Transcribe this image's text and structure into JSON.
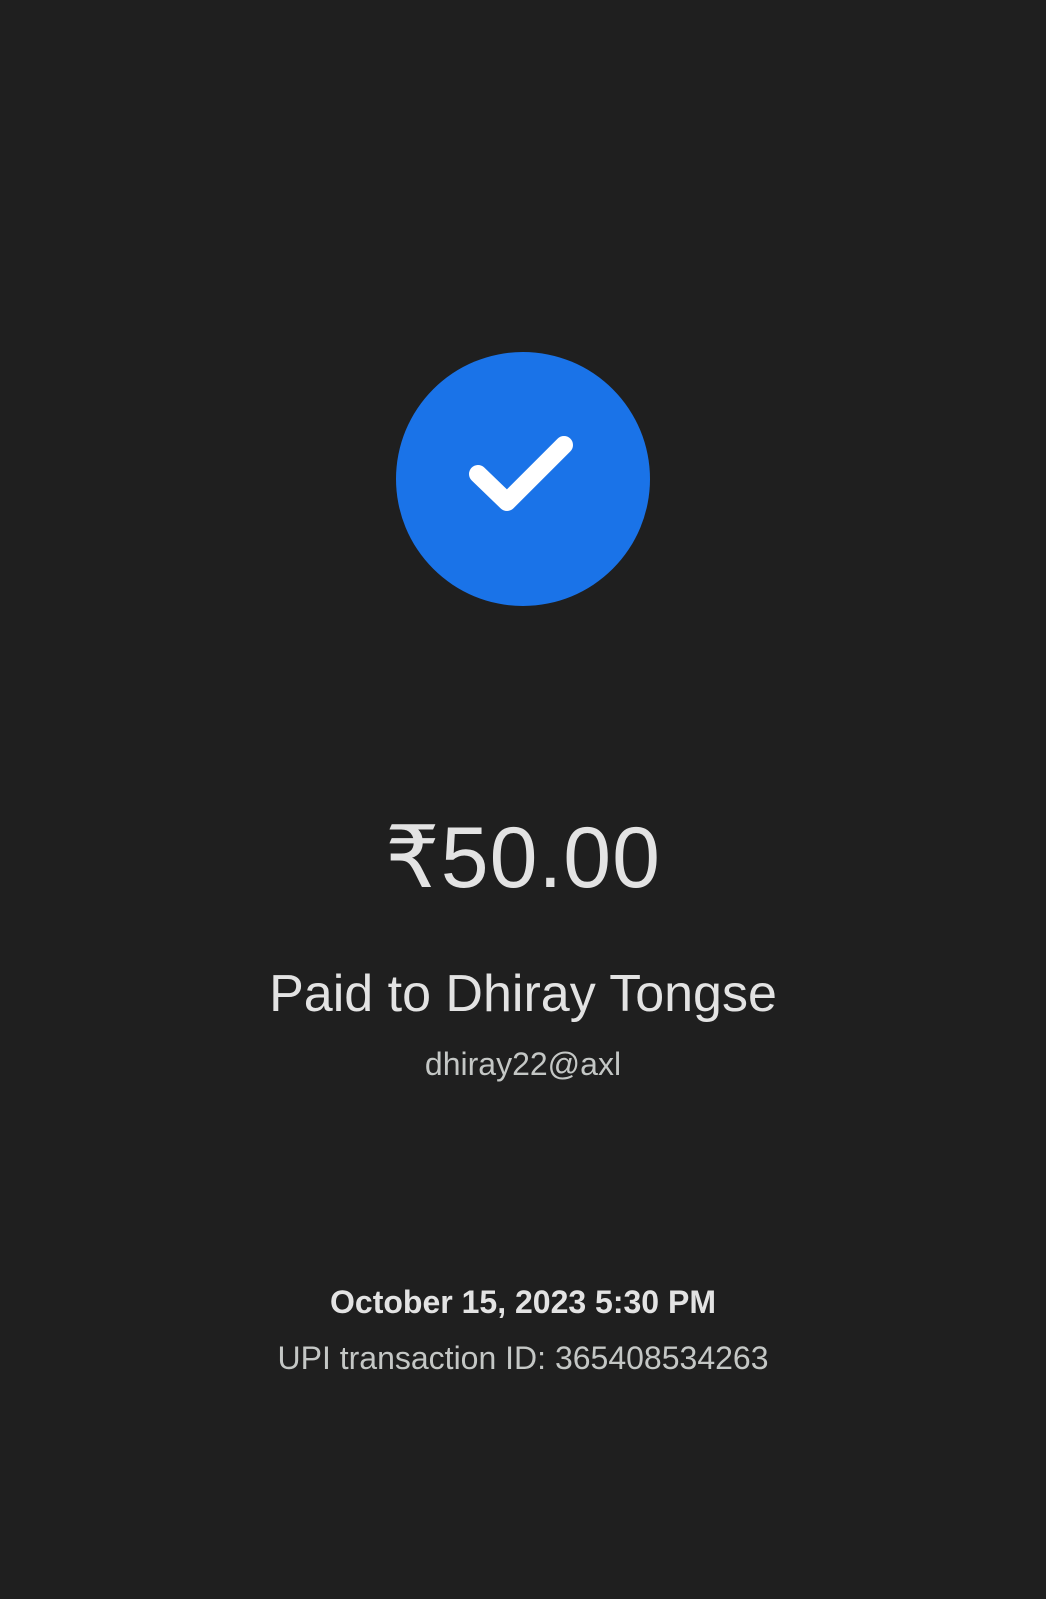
{
  "payment": {
    "status_icon": "check-icon",
    "amount": "₹50.00",
    "paid_to": "Paid to Dhiray Tongse",
    "upi_handle": "dhiray22@axl",
    "datetime": "October 15, 2023 5:30 PM",
    "transaction_id": "UPI transaction ID: 365408534263"
  },
  "colors": {
    "background": "#1f1f1f",
    "accent": "#1a73e8",
    "text_primary": "#e3e3e3",
    "text_secondary": "#c4c7c5"
  }
}
